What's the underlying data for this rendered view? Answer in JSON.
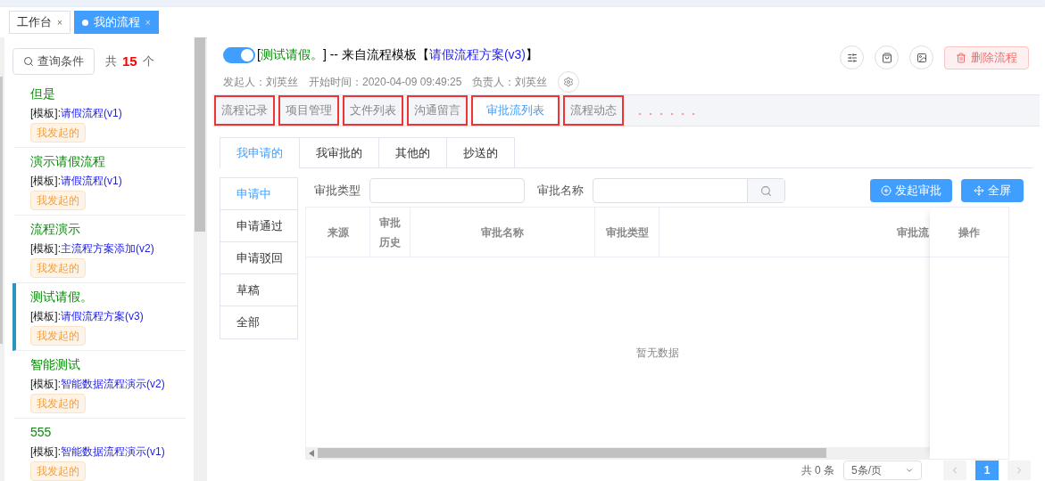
{
  "top_tabs": [
    {
      "label": "工作台",
      "selected": false,
      "close": "×"
    },
    {
      "label": "我的流程",
      "selected": true,
      "close": "×"
    }
  ],
  "sidebar": {
    "search_button": "查询条件",
    "count_prefix": "共",
    "count": "15",
    "count_suffix": "个",
    "items": [
      {
        "title": "但是",
        "label": "[模板]:",
        "template": "请假流程(v1)",
        "tag": "我发起的",
        "selected": false
      },
      {
        "title": "演示请假流程",
        "label": "[模板]:",
        "template": "请假流程(v1)",
        "tag": "我发起的",
        "selected": false
      },
      {
        "title": "流程演示",
        "label": "[模板]:",
        "template": "主流程方案添加(v2)",
        "tag": "我发起的",
        "selected": false
      },
      {
        "title": "测试请假。",
        "label": "[模板]:",
        "template": "请假流程方案(v3)",
        "tag": "我发起的",
        "selected": true
      },
      {
        "title": "智能测试",
        "label": "[模板]:",
        "template": "智能数据流程演示(v2)",
        "tag": "我发起的",
        "selected": false
      },
      {
        "title": "555",
        "label": "[模板]:",
        "template": "智能数据流程演示(v1)",
        "tag": "我发起的",
        "selected": false
      }
    ]
  },
  "header": {
    "toggle_on": true,
    "open_bracket": "[",
    "name": "测试请假。",
    "middle": "] -- 来自流程模板【",
    "template": "请假流程方案(v3)",
    "close_bracket": "】",
    "meta": [
      "发起人：刘英丝",
      "开始时间：2020-04-09 09:49:25",
      "负责人：刘英丝"
    ],
    "delete_button": "删除流程"
  },
  "section_tabs": [
    {
      "label": "流程记录",
      "selected": false,
      "annotated": true
    },
    {
      "label": "项目管理",
      "selected": false,
      "annotated": true
    },
    {
      "label": "文件列表",
      "selected": false,
      "annotated": true
    },
    {
      "label": "沟通留言",
      "selected": false,
      "annotated": true
    },
    {
      "label": "审批流列表",
      "selected": true,
      "annotated": true
    },
    {
      "label": "流程动态",
      "selected": false,
      "annotated": true
    }
  ],
  "annotation_marks": "。。。。。。",
  "sub_tabs": [
    {
      "label": "我申请的",
      "selected": true
    },
    {
      "label": "我审批的",
      "selected": false
    },
    {
      "label": "其他的",
      "selected": false
    },
    {
      "label": "抄送的",
      "selected": false
    }
  ],
  "status_menu": [
    {
      "label": "申请中",
      "selected": true
    },
    {
      "label": "申请通过",
      "selected": false
    },
    {
      "label": "申请驳回",
      "selected": false
    },
    {
      "label": "草稿",
      "selected": false
    },
    {
      "label": "全部",
      "selected": false
    }
  ],
  "filters": {
    "type_label": "审批类型",
    "name_label": "审批名称"
  },
  "buttons": {
    "start": "发起审批",
    "fullscreen": "全屏"
  },
  "table": {
    "columns": [
      "来源",
      "审批历史",
      "审批名称",
      "审批类型",
      "审批流"
    ],
    "action_column": "操作",
    "empty_text": "暂无数据"
  },
  "pagination": {
    "total": "共 0 条",
    "page_size": "5条/页",
    "current_page": "1"
  }
}
